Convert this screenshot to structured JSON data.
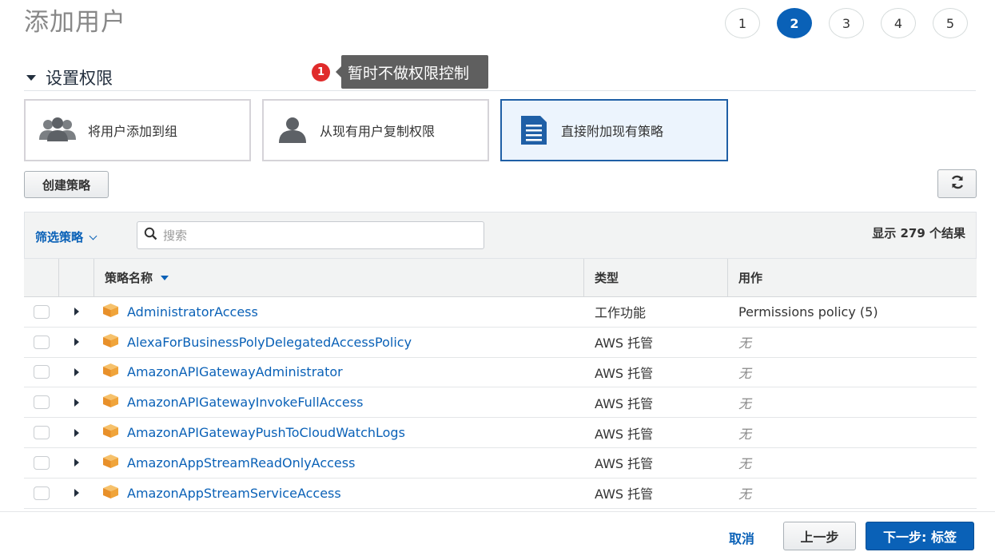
{
  "page": {
    "title": "添加用户"
  },
  "steps": [
    "1",
    "2",
    "3",
    "4",
    "5"
  ],
  "permissions": {
    "section_title": "设置权限",
    "tooltip": {
      "badge": "1",
      "text": "暂时不做权限控制"
    },
    "options": [
      {
        "label": "将用户添加到组",
        "icon": "group-icon"
      },
      {
        "label": "从现有用户复制权限",
        "icon": "user-icon"
      },
      {
        "label": "直接附加现有策略",
        "icon": "document-icon"
      }
    ]
  },
  "toolbar": {
    "create_policy": "创建策略",
    "refresh_icon": "refresh-icon"
  },
  "filter": {
    "label": "筛选策略",
    "search_placeholder": "搜索",
    "result_count": "显示 279 个结果"
  },
  "table": {
    "columns": [
      "策略名称",
      "类型",
      "用作"
    ],
    "rows": [
      {
        "name": "AdministratorAccess",
        "type": "工作功能",
        "use": "Permissions policy (5)"
      },
      {
        "name": "AlexaForBusinessPolyDelegatedAccessPolicy",
        "type": "AWS 托管",
        "use": "无"
      },
      {
        "name": "AmazonAPIGatewayAdministrator",
        "type": "AWS 托管",
        "use": "无"
      },
      {
        "name": "AmazonAPIGatewayInvokeFullAccess",
        "type": "AWS 托管",
        "use": "无"
      },
      {
        "name": "AmazonAPIGatewayPushToCloudWatchLogs",
        "type": "AWS 托管",
        "use": "无"
      },
      {
        "name": "AmazonAppStreamReadOnlyAccess",
        "type": "AWS 托管",
        "use": "无"
      },
      {
        "name": "AmazonAppStreamServiceAccess",
        "type": "AWS 托管",
        "use": "无"
      }
    ]
  },
  "footer": {
    "cancel": "取消",
    "previous": "上一步",
    "next": "下一步: 标签"
  },
  "colors": {
    "accent": "#0a61b7",
    "policy_icon": "#f0a43a",
    "badge": "#e02b2b"
  }
}
